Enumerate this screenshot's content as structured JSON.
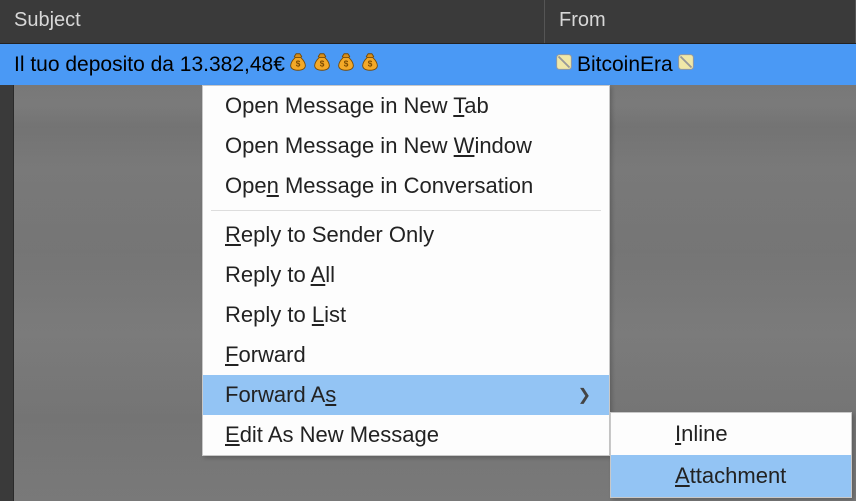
{
  "columns": {
    "subject": "Subject",
    "from": "From"
  },
  "message": {
    "subject_text": "Il tuo deposito da 13.382,48€",
    "from_text": "BitcoinEra"
  },
  "menu": {
    "open_tab": {
      "pre": "Open Message in New ",
      "accel": "T",
      "post": "ab"
    },
    "open_window": {
      "pre": "Open Message in New ",
      "accel": "W",
      "post": "indow"
    },
    "open_conv": {
      "pre": "Ope",
      "accel": "n",
      "post": " Message in Conversation"
    },
    "reply_sender": {
      "pre": "",
      "accel": "R",
      "post": "eply to Sender Only"
    },
    "reply_all": {
      "pre": "Reply to ",
      "accel": "A",
      "post": "ll"
    },
    "reply_list": {
      "pre": "Reply to ",
      "accel": "L",
      "post": "ist"
    },
    "forward": {
      "pre": "",
      "accel": "F",
      "post": "orward"
    },
    "forward_as": {
      "pre": "Forward A",
      "accel": "s",
      "post": ""
    },
    "edit_new": {
      "pre": "",
      "accel": "E",
      "post": "dit As New Message"
    }
  },
  "submenu": {
    "inline": {
      "pre": "",
      "accel": "I",
      "post": "nline"
    },
    "attachment": {
      "pre": "",
      "accel": "A",
      "post": "ttachment"
    }
  }
}
